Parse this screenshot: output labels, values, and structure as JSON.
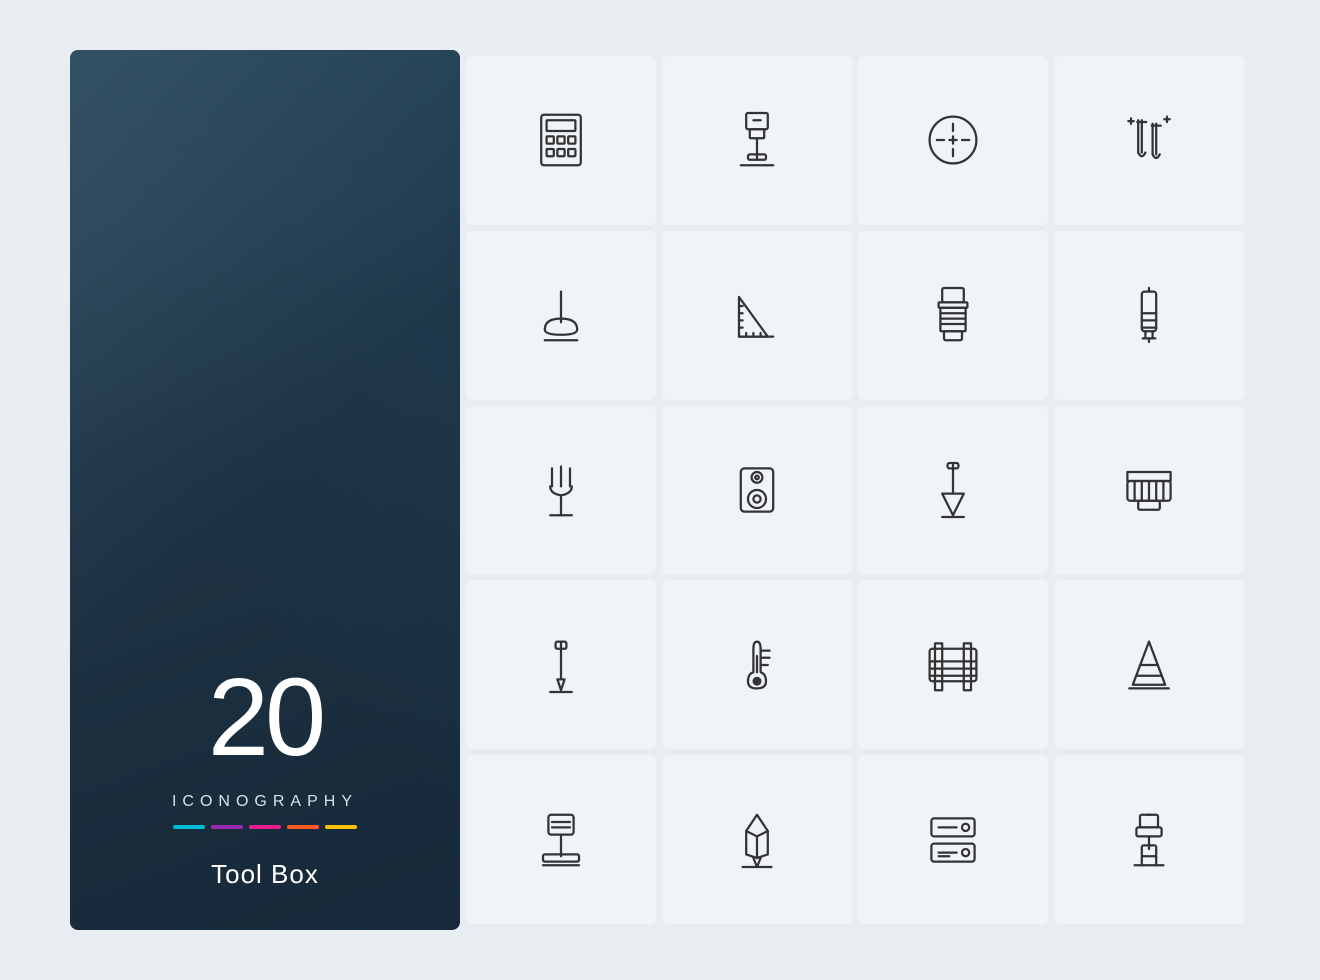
{
  "left": {
    "number": "20",
    "iconography": "ICONOGRAPHY",
    "title": "Tool Box",
    "colors": [
      "#00bcd4",
      "#9c27b0",
      "#e91e8c",
      "#ff5722",
      "#ffc107"
    ]
  },
  "icons": [
    {
      "name": "calculator-icon",
      "label": "Calculator"
    },
    {
      "name": "drill-press-icon",
      "label": "Drill Press"
    },
    {
      "name": "tuner-icon",
      "label": "Tuner"
    },
    {
      "name": "test-tubes-icon",
      "label": "Test Tubes"
    },
    {
      "name": "plunger-icon",
      "label": "Plunger"
    },
    {
      "name": "set-square-icon",
      "label": "Set Square"
    },
    {
      "name": "bolt-icon",
      "label": "Bolt"
    },
    {
      "name": "syringe-icon",
      "label": "Syringe"
    },
    {
      "name": "garden-fork-icon",
      "label": "Garden Fork"
    },
    {
      "name": "speaker-icon",
      "label": "Speaker"
    },
    {
      "name": "plumb-bob-icon",
      "label": "Plumb Bob"
    },
    {
      "name": "paint-brush-icon",
      "label": "Paint Brush"
    },
    {
      "name": "soldering-iron-icon",
      "label": "Soldering Iron"
    },
    {
      "name": "thermometer-icon",
      "label": "Thermometer"
    },
    {
      "name": "cable-reel-icon",
      "label": "Cable Reel"
    },
    {
      "name": "traffic-cone-icon",
      "label": "Traffic Cone"
    },
    {
      "name": "podium-icon",
      "label": "Podium"
    },
    {
      "name": "pen-tool-icon",
      "label": "Pen Tool"
    },
    {
      "name": "server-icon",
      "label": "Server"
    },
    {
      "name": "milling-machine-icon",
      "label": "Milling Machine"
    }
  ]
}
